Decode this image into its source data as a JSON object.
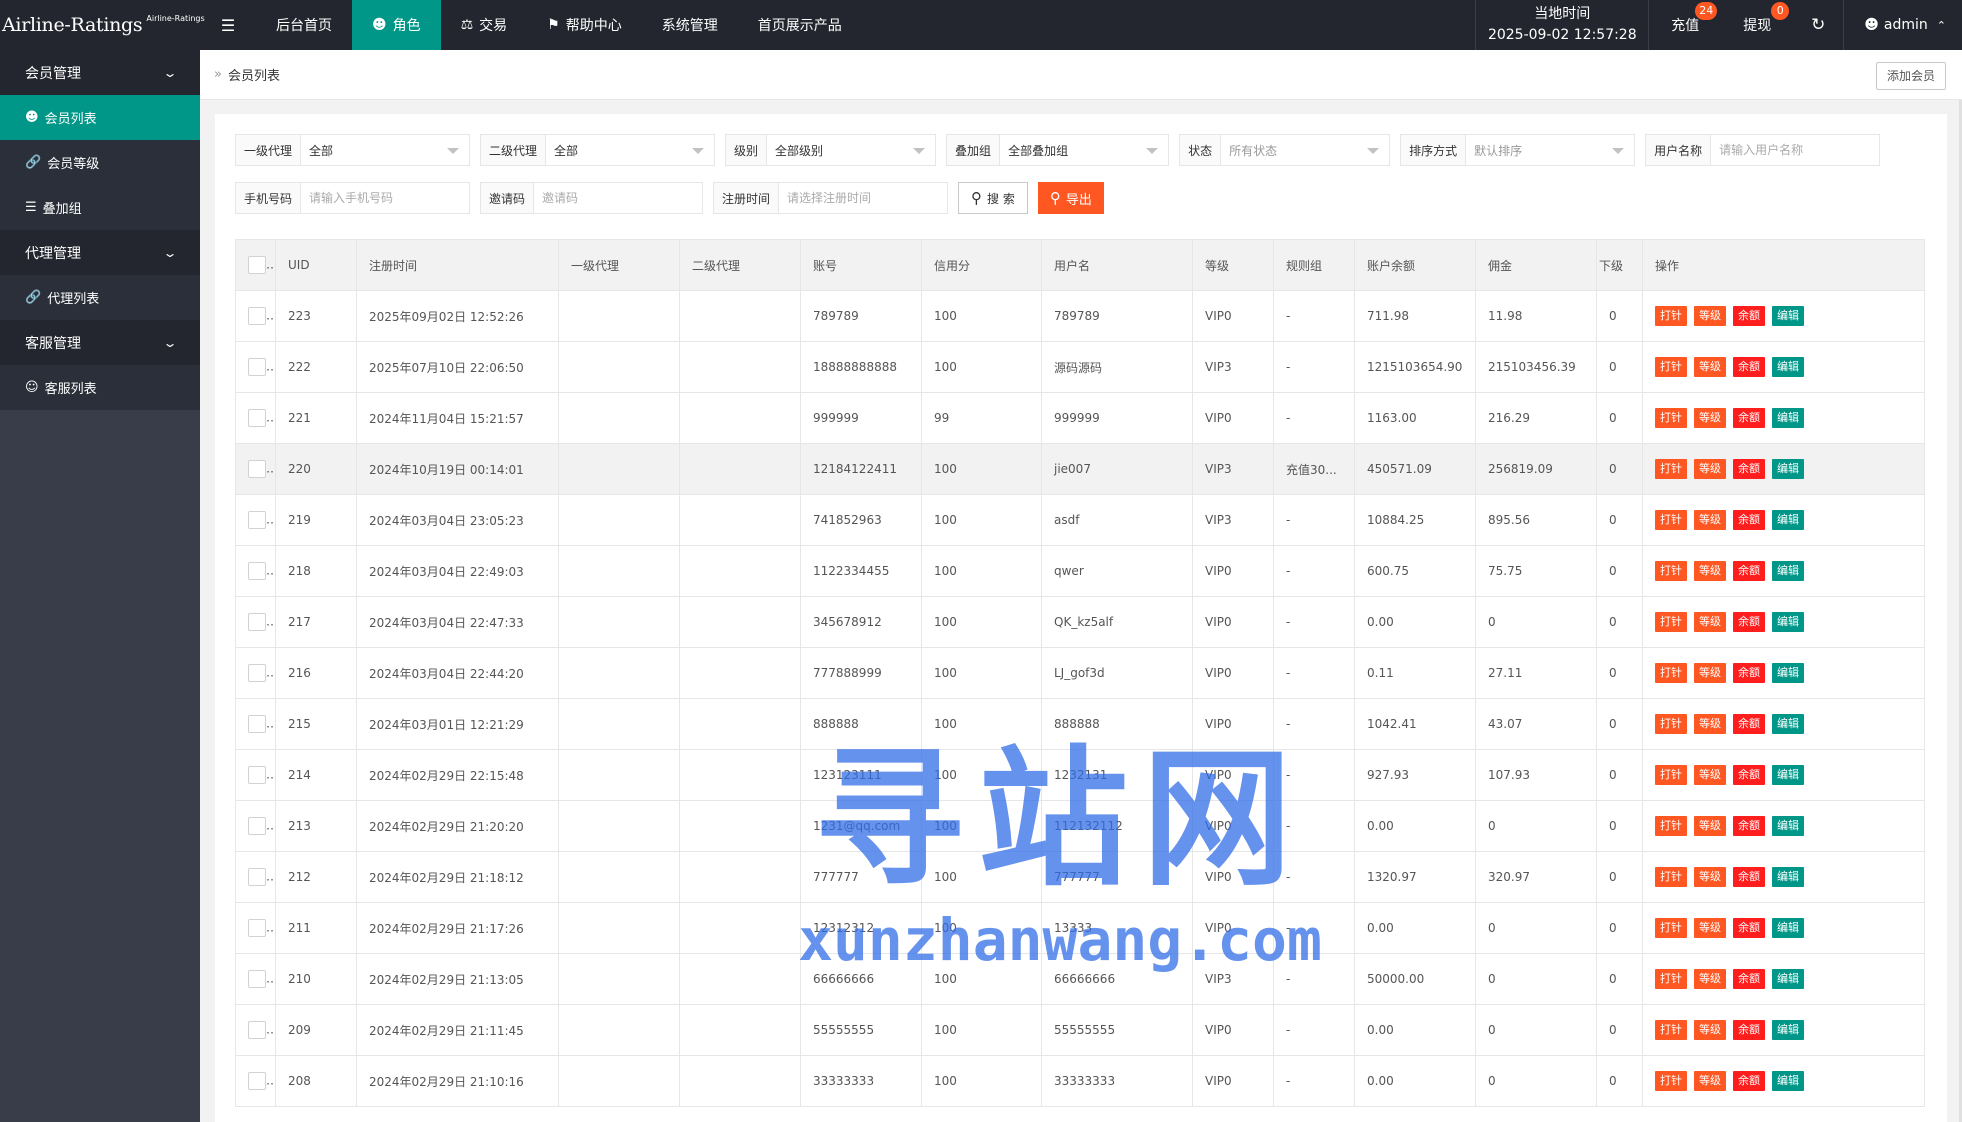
{
  "brand": {
    "title": "Airline-Ratings",
    "subtitle": "Airline-Ratings"
  },
  "nav": [
    {
      "label": "后台首页",
      "icon": ""
    },
    {
      "label": "角色",
      "icon": "user-icon"
    },
    {
      "label": "交易",
      "icon": "scale-icon"
    },
    {
      "label": "帮助中心",
      "icon": "flag-icon"
    },
    {
      "label": "系统管理",
      "icon": ""
    },
    {
      "label": "首页展示产品",
      "icon": ""
    }
  ],
  "clock": {
    "label": "当地时间",
    "value": "2025-09-02 12:57:28"
  },
  "topright": {
    "recharge": "充值",
    "recharge_badge": "24",
    "withdraw": "提现",
    "withdraw_badge": "0",
    "user": "admin"
  },
  "sidebar": {
    "g1": "会员管理",
    "g1_items": [
      "会员列表",
      "会员等级",
      "叠加组"
    ],
    "g2": "代理管理",
    "g2_items": [
      "代理列表"
    ],
    "g3": "客服管理",
    "g3_items": [
      "客服列表"
    ]
  },
  "breadcrumb": {
    "current": "会员列表",
    "add_button": "添加会员"
  },
  "filters": {
    "agent1": {
      "label": "一级代理",
      "value": "全部"
    },
    "agent2": {
      "label": "二级代理",
      "value": "全部"
    },
    "level": {
      "label": "级别",
      "value": "全部级别"
    },
    "stack": {
      "label": "叠加组",
      "value": "全部叠加组"
    },
    "status": {
      "label": "状态",
      "value": "所有状态"
    },
    "sort": {
      "label": "排序方式",
      "value": "默认排序"
    },
    "username": {
      "label": "用户名称",
      "placeholder": "请输入用户名称"
    },
    "phone": {
      "label": "手机号码",
      "placeholder": "请输入手机号码"
    },
    "invite": {
      "label": "邀请码",
      "placeholder": "邀请码"
    },
    "regtime": {
      "label": "注册时间",
      "placeholder": "请选择注册时间"
    },
    "search_button": "搜 索",
    "export_button": "导出"
  },
  "table": {
    "headers": [
      "UID",
      "注册时间",
      "一级代理",
      "二级代理",
      "账号",
      "信用分",
      "用户名",
      "等级",
      "规则组",
      "账户余额",
      "佣金",
      "下级",
      "操作"
    ],
    "actions": [
      "打针",
      "等级",
      "余额",
      "编辑"
    ],
    "rows": [
      [
        "223",
        "2025年09月02日 12:52:26",
        "",
        "",
        "789789",
        "100",
        "789789",
        "VIP0",
        "-",
        "711.98",
        "11.98",
        "0"
      ],
      [
        "222",
        "2025年07月10日 22:06:50",
        "",
        "",
        "18888888888",
        "100",
        "源码源码",
        "VIP3",
        "-",
        "1215103654.90",
        "215103456.39",
        "0"
      ],
      [
        "221",
        "2024年11月04日 15:21:57",
        "",
        "",
        "999999",
        "99",
        "999999",
        "VIP0",
        "-",
        "1163.00",
        "216.29",
        "0"
      ],
      [
        "220",
        "2024年10月19日 00:14:01",
        "",
        "",
        "12184122411",
        "100",
        "jie007",
        "VIP3",
        "充值30...",
        "450571.09",
        "256819.09",
        "0"
      ],
      [
        "219",
        "2024年03月04日 23:05:23",
        "",
        "",
        "741852963",
        "100",
        "asdf",
        "VIP3",
        "-",
        "10884.25",
        "895.56",
        "0"
      ],
      [
        "218",
        "2024年03月04日 22:49:03",
        "",
        "",
        "1122334455",
        "100",
        "qwer",
        "VIP0",
        "-",
        "600.75",
        "75.75",
        "0"
      ],
      [
        "217",
        "2024年03月04日 22:47:33",
        "",
        "",
        "345678912",
        "100",
        "QK_kz5alf",
        "VIP0",
        "-",
        "0.00",
        "0",
        "0"
      ],
      [
        "216",
        "2024年03月04日 22:44:20",
        "",
        "",
        "777888999",
        "100",
        "LJ_gof3d",
        "VIP0",
        "-",
        "0.11",
        "27.11",
        "0"
      ],
      [
        "215",
        "2024年03月01日 12:21:29",
        "",
        "",
        "888888",
        "100",
        "888888",
        "VIP0",
        "-",
        "1042.41",
        "43.07",
        "0"
      ],
      [
        "214",
        "2024年02月29日 22:15:48",
        "",
        "",
        "123123111",
        "100",
        "1232131",
        "VIP0",
        "-",
        "927.93",
        "107.93",
        "0"
      ],
      [
        "213",
        "2024年02月29日 21:20:20",
        "",
        "",
        "1231@qq.com",
        "100",
        "112132112",
        "VIP0",
        "-",
        "0.00",
        "0",
        "0"
      ],
      [
        "212",
        "2024年02月29日 21:18:12",
        "",
        "",
        "777777",
        "100",
        "777777",
        "VIP0",
        "-",
        "1320.97",
        "320.97",
        "0"
      ],
      [
        "211",
        "2024年02月29日 21:17:26",
        "",
        "",
        "12312312",
        "100",
        "13333",
        "VIP0",
        "-",
        "0.00",
        "0",
        "0"
      ],
      [
        "210",
        "2024年02月29日 21:13:05",
        "",
        "",
        "66666666",
        "100",
        "66666666",
        "VIP3",
        "-",
        "50000.00",
        "0",
        "0"
      ],
      [
        "209",
        "2024年02月29日 21:11:45",
        "",
        "",
        "55555555",
        "100",
        "55555555",
        "VIP0",
        "-",
        "0.00",
        "0",
        "0"
      ],
      [
        "208",
        "2024年02月29日 21:10:16",
        "",
        "",
        "33333333",
        "100",
        "33333333",
        "VIP0",
        "-",
        "0.00",
        "0",
        "0"
      ]
    ],
    "highlight_index": 3
  },
  "watermark": {
    "big": "寻站网",
    "small": "xunzhanwang.com"
  },
  "colors": {
    "topbar": "#23262e",
    "sidebar": "#393d49",
    "accent": "#009688",
    "orange": "#ff5722",
    "red": "#ff1e1e"
  }
}
